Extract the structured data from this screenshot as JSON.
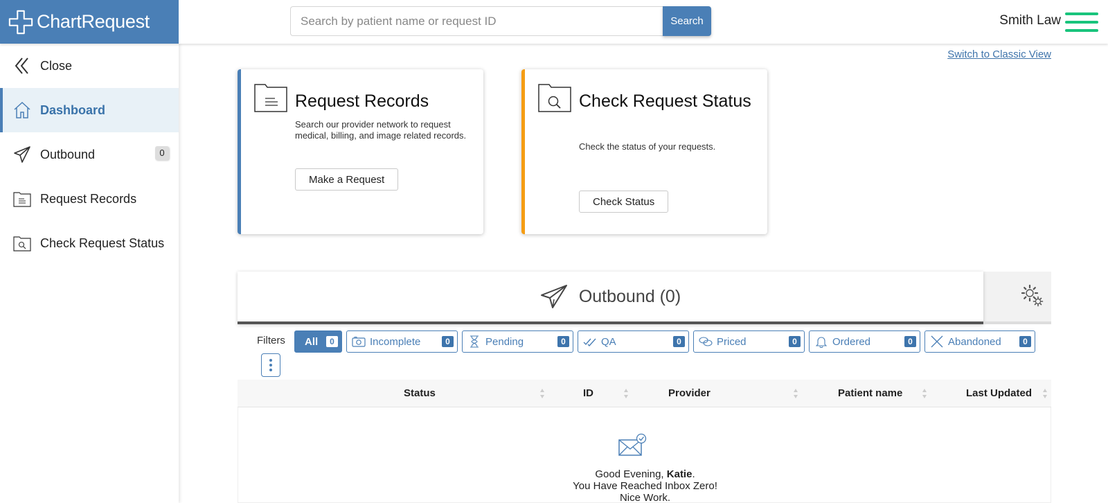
{
  "brand": {
    "name": "ChartRequest"
  },
  "search": {
    "placeholder": "Search by patient name or request ID",
    "value": "",
    "button_label": "Search"
  },
  "user": {
    "name": "Smith Law"
  },
  "sidebar": {
    "items": [
      {
        "label": "Close",
        "icon": "double-chevron-left-icon"
      },
      {
        "label": "Dashboard",
        "icon": "home-icon",
        "active": true
      },
      {
        "label": "Outbound",
        "icon": "paper-plane-icon",
        "badge": "0"
      },
      {
        "label": "Request Records",
        "icon": "folder-document-icon"
      },
      {
        "label": "Check Request Status",
        "icon": "folder-search-icon"
      }
    ]
  },
  "switch_link": "Switch to Classic View",
  "cards": {
    "request_records": {
      "title": "Request Records",
      "description": "Search our provider network to request medical, billing, and image related records.",
      "button": "Make a Request"
    },
    "check_status": {
      "title": "Check Request Status",
      "description": "Check the status of your requests.",
      "button": "Check Status"
    }
  },
  "outbound": {
    "title": "Outbound (0)"
  },
  "filters": {
    "label": "Filters",
    "chips": [
      {
        "label": "All",
        "count": "0"
      },
      {
        "label": "Incomplete",
        "count": "0",
        "icon": "camera-icon"
      },
      {
        "label": "Pending",
        "count": "0",
        "icon": "hourglass-icon"
      },
      {
        "label": "QA",
        "count": "0",
        "icon": "double-check-icon"
      },
      {
        "label": "Priced",
        "count": "0",
        "icon": "coins-icon"
      },
      {
        "label": "Ordered",
        "count": "0",
        "icon": "bell-icon"
      },
      {
        "label": "Abandoned",
        "count": "0",
        "icon": "x-icon"
      }
    ]
  },
  "table": {
    "columns": [
      "Status",
      "ID",
      "Provider",
      "Patient name",
      "Last Updated"
    ]
  },
  "empty_state": {
    "greeting": "Good Evening, ",
    "user_first_name": "Katie",
    "greeting_end": ".",
    "line2": "You Have Reached Inbox Zero!",
    "line3": "Nice Work."
  },
  "colors": {
    "brand_blue": "#4a7fb6",
    "accent_orange": "#f59d14",
    "menu_green": "#19c47c"
  }
}
